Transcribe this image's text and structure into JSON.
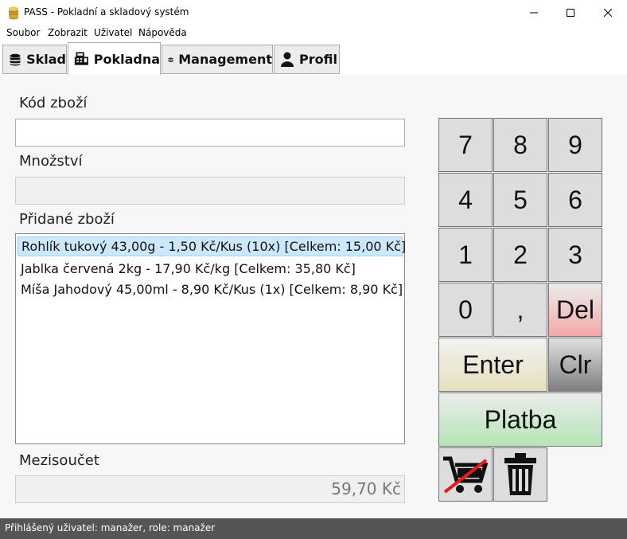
{
  "window": {
    "title": "PASS - Pokladní a skladový systém"
  },
  "menu": [
    "Soubor",
    "Zobrazit",
    "Uživatel",
    "Nápověda"
  ],
  "tabs": [
    {
      "label": "Sklad",
      "icon": "database-icon"
    },
    {
      "label": "Pokladna",
      "icon": "cash-register-icon",
      "active": true
    },
    {
      "label": "Management",
      "icon": "users-icon"
    },
    {
      "label": "Profil",
      "icon": "user-icon"
    }
  ],
  "form": {
    "code_label": "Kód zboží",
    "code_value": "",
    "quantity_label": "Množství",
    "quantity_value": "",
    "added_label": "Přidané zboží",
    "items": [
      "Rohlík tukový 43,00g - 1,50 Kč/Kus (10x) [Celkem: 15,00 Kč]",
      "Jablka červená 2kg - 17,90 Kč/kg [Celkem: 35,80 Kč]",
      "Míša Jahodový 45,00ml - 8,90 Kč/Kus (1x) [Celkem: 8,90 Kč]"
    ],
    "selected_index": 0,
    "subtotal_label": "Mezisoučet",
    "subtotal_value": "59,70 Kč"
  },
  "keypad": {
    "k7": "7",
    "k8": "8",
    "k9": "9",
    "k4": "4",
    "k5": "5",
    "k6": "6",
    "k1": "1",
    "k2": "2",
    "k3": "3",
    "k0": "0",
    "comma": ",",
    "del": "Del",
    "enter": "Enter",
    "clr": "Clr",
    "pay": "Platba",
    "cancel_cart_icon": "cart-cancel-icon",
    "trash_icon": "trash-icon"
  },
  "colors": {
    "del": "#f5b8b8",
    "enter": "#ece6c8",
    "clr": "#8a8a8a",
    "pay": "#bfe8bf",
    "statusbar": "#555555"
  },
  "status": "Přihlášený uživatel: manažer, role: manažer"
}
